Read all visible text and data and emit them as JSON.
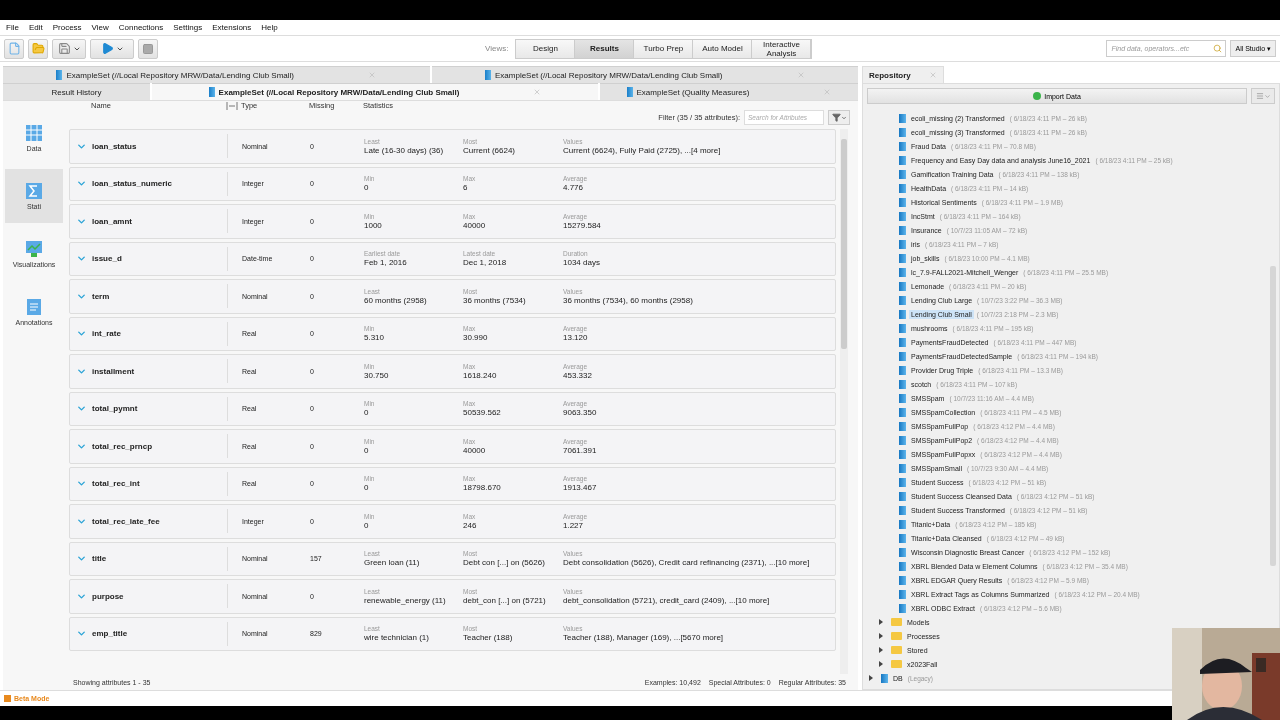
{
  "menu": [
    "File",
    "Edit",
    "Process",
    "View",
    "Connections",
    "Settings",
    "Extensions",
    "Help"
  ],
  "views": {
    "label": "Views:",
    "buttons": [
      {
        "label": "Design",
        "selected": false
      },
      {
        "label": "Results",
        "selected": true
      },
      {
        "label": "Turbo Prep",
        "selected": false
      },
      {
        "label": "Auto Model",
        "selected": false
      },
      {
        "label": "Interactive Analysis",
        "selected": false
      }
    ]
  },
  "search": {
    "placeholder": "Find data, operators...etc",
    "scope": "All Studio ▾"
  },
  "result_tabs_top": [
    {
      "label": "ExampleSet (//Local Repository MRW/Data/Lending Club Small)"
    },
    {
      "label": "ExampleSet (//Local Repository MRW/Data/Lending Club Small)"
    }
  ],
  "result_tabs": [
    {
      "label": "Result History",
      "selected": false,
      "icon": false
    },
    {
      "label": "ExampleSet (//Local Repository MRW/Data/Lending Club Small)",
      "selected": true,
      "icon": true
    },
    {
      "label": "ExampleSet (Quality Measures)",
      "selected": false,
      "icon": true
    }
  ],
  "side_nav": [
    {
      "label": "Data",
      "kind": "data",
      "selected": false
    },
    {
      "label": "Stati",
      "kind": "statistics",
      "selected": true
    },
    {
      "label": "Visualizations",
      "kind": "visualizations",
      "selected": false
    },
    {
      "label": "Annotations",
      "kind": "annotations",
      "selected": false
    }
  ],
  "table": {
    "columns": [
      "Name",
      "Type",
      "Missing",
      "Statistics"
    ],
    "filter": "Filter (35 / 35 attributes):",
    "filter_placeholder": "Search for Attributes",
    "rows": [
      {
        "name": "loan_status",
        "type": "Nominal",
        "missing": "0",
        "stats": [
          [
            "Least",
            "Late (16-30 days) (36)"
          ],
          [
            "Most",
            "Current (6624)"
          ],
          [
            "Values",
            "Current (6624), Fully Paid (2725), ...[4 more]"
          ]
        ]
      },
      {
        "name": "loan_status_numeric",
        "type": "Integer",
        "missing": "0",
        "stats": [
          [
            "Min",
            "0"
          ],
          [
            "Max",
            "6"
          ],
          [
            "Average",
            "4.776"
          ]
        ]
      },
      {
        "name": "loan_amnt",
        "type": "Integer",
        "missing": "0",
        "stats": [
          [
            "Min",
            "1000"
          ],
          [
            "Max",
            "40000"
          ],
          [
            "Average",
            "15279.584"
          ]
        ]
      },
      {
        "name": "issue_d",
        "type": "Date-time",
        "missing": "0",
        "stats": [
          [
            "Earliest date",
            "Feb 1, 2016"
          ],
          [
            "Latest date",
            "Dec 1, 2018"
          ],
          [
            "Duration",
            "1034 days"
          ]
        ]
      },
      {
        "name": "term",
        "type": "Nominal",
        "missing": "0",
        "stats": [
          [
            "Least",
            "60 months (2958)"
          ],
          [
            "Most",
            "36 months (7534)"
          ],
          [
            "Values",
            "36 months (7534), 60 months (2958)"
          ]
        ]
      },
      {
        "name": "int_rate",
        "type": "Real",
        "missing": "0",
        "stats": [
          [
            "Min",
            "5.310"
          ],
          [
            "Max",
            "30.990"
          ],
          [
            "Average",
            "13.120"
          ]
        ]
      },
      {
        "name": "installment",
        "type": "Real",
        "missing": "0",
        "stats": [
          [
            "Min",
            "30.750"
          ],
          [
            "Max",
            "1618.240"
          ],
          [
            "Average",
            "453.332"
          ]
        ]
      },
      {
        "name": "total_pymnt",
        "type": "Real",
        "missing": "0",
        "stats": [
          [
            "Min",
            "0"
          ],
          [
            "Max",
            "50539.562"
          ],
          [
            "Average",
            "9063.350"
          ]
        ]
      },
      {
        "name": "total_rec_prncp",
        "type": "Real",
        "missing": "0",
        "stats": [
          [
            "Min",
            "0"
          ],
          [
            "Max",
            "40000"
          ],
          [
            "Average",
            "7061.391"
          ]
        ]
      },
      {
        "name": "total_rec_int",
        "type": "Real",
        "missing": "0",
        "stats": [
          [
            "Min",
            "0"
          ],
          [
            "Max",
            "18798.670"
          ],
          [
            "Average",
            "1913.467"
          ]
        ]
      },
      {
        "name": "total_rec_late_fee",
        "type": "Integer",
        "missing": "0",
        "stats": [
          [
            "Min",
            "0"
          ],
          [
            "Max",
            "246"
          ],
          [
            "Average",
            "1.227"
          ]
        ]
      },
      {
        "name": "title",
        "type": "Nominal",
        "missing": "157",
        "stats": [
          [
            "Least",
            "Green loan (11)"
          ],
          [
            "Most",
            "Debt con [...] on (5626)"
          ],
          [
            "Values",
            "Debt consolidation (5626), Credit card refinancing (2371), ...[10 more]"
          ]
        ]
      },
      {
        "name": "purpose",
        "type": "Nominal",
        "missing": "0",
        "stats": [
          [
            "Least",
            "renewable_energy (11)"
          ],
          [
            "Most",
            "debt_con [...] on (5721)"
          ],
          [
            "Values",
            "debt_consolidation (5721), credit_card (2409), ...[10 more]"
          ]
        ]
      },
      {
        "name": "emp_title",
        "type": "Nominal",
        "missing": "829",
        "stats": [
          [
            "Least",
            "wire technician  (1)"
          ],
          [
            "Most",
            "Teacher (188)"
          ],
          [
            "Values",
            "Teacher (188), Manager (169), ...[5670 more]"
          ]
        ]
      }
    ]
  },
  "status": {
    "showing": "Showing attributes 1 - 35",
    "examples": "Examples: 10,492",
    "special": "Special Attributes: 0",
    "regular": "Regular Attributes: 35"
  },
  "repository": {
    "title": "Repository",
    "import_button": "Import Data",
    "items": [
      {
        "kind": "data",
        "name": "ecoli_missing (2) Transformed",
        "meta": "( 6/18/23 4:11 PM – 26 kB)",
        "selected": false
      },
      {
        "kind": "data",
        "name": "ecoli_missing (3) Transformed",
        "meta": "( 6/18/23 4:11 PM – 26 kB)",
        "selected": false
      },
      {
        "kind": "data",
        "name": "Fraud Data",
        "meta": "( 6/18/23 4:11 PM – 70.8 MB)",
        "selected": false
      },
      {
        "kind": "data",
        "name": "Frequency and Easy Day data and analysis June16_2021",
        "meta": "( 6/18/23 4:11 PM – 25 kB)",
        "selected": false
      },
      {
        "kind": "data",
        "name": "Gamification Training Data",
        "meta": "( 6/18/23 4:11 PM – 138 kB)",
        "selected": false
      },
      {
        "kind": "data",
        "name": "HealthData",
        "meta": "( 6/18/23 4:11 PM – 14 kB)",
        "selected": false
      },
      {
        "kind": "data",
        "name": "Historical Sentiments",
        "meta": "( 6/18/23 4:11 PM – 1.9 MB)",
        "selected": false
      },
      {
        "kind": "data",
        "name": "IncStmt",
        "meta": "( 6/18/23 4:11 PM – 164 kB)",
        "selected": false
      },
      {
        "kind": "data",
        "name": "Insurance",
        "meta": "( 10/7/23 11:05 AM – 72 kB)",
        "selected": false
      },
      {
        "kind": "data",
        "name": "iris",
        "meta": "( 6/18/23 4:11 PM – 7 kB)",
        "selected": false
      },
      {
        "kind": "data",
        "name": "job_skills",
        "meta": "( 6/18/23 10:00 PM – 4.1 MB)",
        "selected": false
      },
      {
        "kind": "data",
        "name": "lc_7.9-FALL2021-Mitchell_Wenger",
        "meta": "( 6/18/23 4:11 PM – 25.5 MB)",
        "selected": false
      },
      {
        "kind": "data",
        "name": "Lemonade",
        "meta": "( 6/18/23 4:11 PM – 20 kB)",
        "selected": false
      },
      {
        "kind": "data",
        "name": "Lending Club Large",
        "meta": "( 10/7/23 3:22 PM – 36.3 MB)",
        "selected": false
      },
      {
        "kind": "data",
        "name": "Lending Club Small",
        "meta": "( 10/7/23 2:18 PM – 2.3 MB)",
        "selected": true
      },
      {
        "kind": "data",
        "name": "mushrooms",
        "meta": "( 6/18/23 4:11 PM – 195 kB)",
        "selected": false
      },
      {
        "kind": "data",
        "name": "PaymentsFraudDetected",
        "meta": "( 6/18/23 4:11 PM – 447 MB)",
        "selected": false
      },
      {
        "kind": "data",
        "name": "PaymentsFraudDetectedSample",
        "meta": "( 6/18/23 4:11 PM – 194 kB)",
        "selected": false
      },
      {
        "kind": "data",
        "name": "Provider Drug Triple",
        "meta": "( 6/18/23 4:11 PM – 13.3 MB)",
        "selected": false
      },
      {
        "kind": "data",
        "name": "scotch",
        "meta": "( 6/18/23 4:11 PM – 107 kB)",
        "selected": false
      },
      {
        "kind": "data",
        "name": "SMSSpam",
        "meta": "( 10/7/23 11:16 AM – 4.4 MB)",
        "selected": false
      },
      {
        "kind": "data",
        "name": "SMSSpamCollection",
        "meta": "( 6/18/23 4:11 PM – 4.5 MB)",
        "selected": false
      },
      {
        "kind": "data",
        "name": "SMSSpamFullPop",
        "meta": "( 6/18/23 4:12 PM – 4.4 MB)",
        "selected": false
      },
      {
        "kind": "data",
        "name": "SMSSpamFullPop2",
        "meta": "( 6/18/23 4:12 PM – 4.4 MB)",
        "selected": false
      },
      {
        "kind": "data",
        "name": "SMSSpamFullPopxx",
        "meta": "( 6/18/23 4:12 PM – 4.4 MB)",
        "selected": false
      },
      {
        "kind": "data",
        "name": "SMSSpamSmall",
        "meta": "( 10/7/23 9:30 AM – 4.4 MB)",
        "selected": false
      },
      {
        "kind": "data",
        "name": "Student Success",
        "meta": "( 6/18/23 4:12 PM – 51 kB)",
        "selected": false
      },
      {
        "kind": "data",
        "name": "Student Success Cleansed Data",
        "meta": "( 6/18/23 4:12 PM – 51 kB)",
        "selected": false
      },
      {
        "kind": "data",
        "name": "Student Success Transformed",
        "meta": "( 6/18/23 4:12 PM – 51 kB)",
        "selected": false
      },
      {
        "kind": "data",
        "name": "Titanic+Data",
        "meta": "( 6/18/23 4:12 PM – 185 kB)",
        "selected": false
      },
      {
        "kind": "data",
        "name": "Titanic+Data Cleansed",
        "meta": "( 6/18/23 4:12 PM – 49 kB)",
        "selected": false
      },
      {
        "kind": "data",
        "name": "Wisconsin Diagnostic Breast Cancer",
        "meta": "( 6/18/23 4:12 PM – 152 kB)",
        "selected": false
      },
      {
        "kind": "data",
        "name": "XBRL Blended Data w Element Columns",
        "meta": "( 6/18/23 4:12 PM – 35.4 MB)",
        "selected": false
      },
      {
        "kind": "data",
        "name": "XBRL EDGAR Query Results",
        "meta": "( 6/18/23 4:12 PM – 5.9 MB)",
        "selected": false
      },
      {
        "kind": "data",
        "name": "XBRL Extract Tags as Columns Summarized",
        "meta": "( 6/18/23 4:12 PM – 20.4 MB)",
        "selected": false
      },
      {
        "kind": "data",
        "name": "XBRL ODBC Extract",
        "meta": "( 6/18/23 4:12 PM – 5.6 MB)",
        "selected": false
      },
      {
        "kind": "folder",
        "name": "Models"
      },
      {
        "kind": "folder",
        "name": "Processes"
      },
      {
        "kind": "folder",
        "name": "Stored"
      },
      {
        "kind": "folder",
        "name": "x2023Fall"
      },
      {
        "kind": "repo",
        "name": "DB",
        "meta": "(Legacy)"
      }
    ]
  },
  "beta": "Beta Mode"
}
